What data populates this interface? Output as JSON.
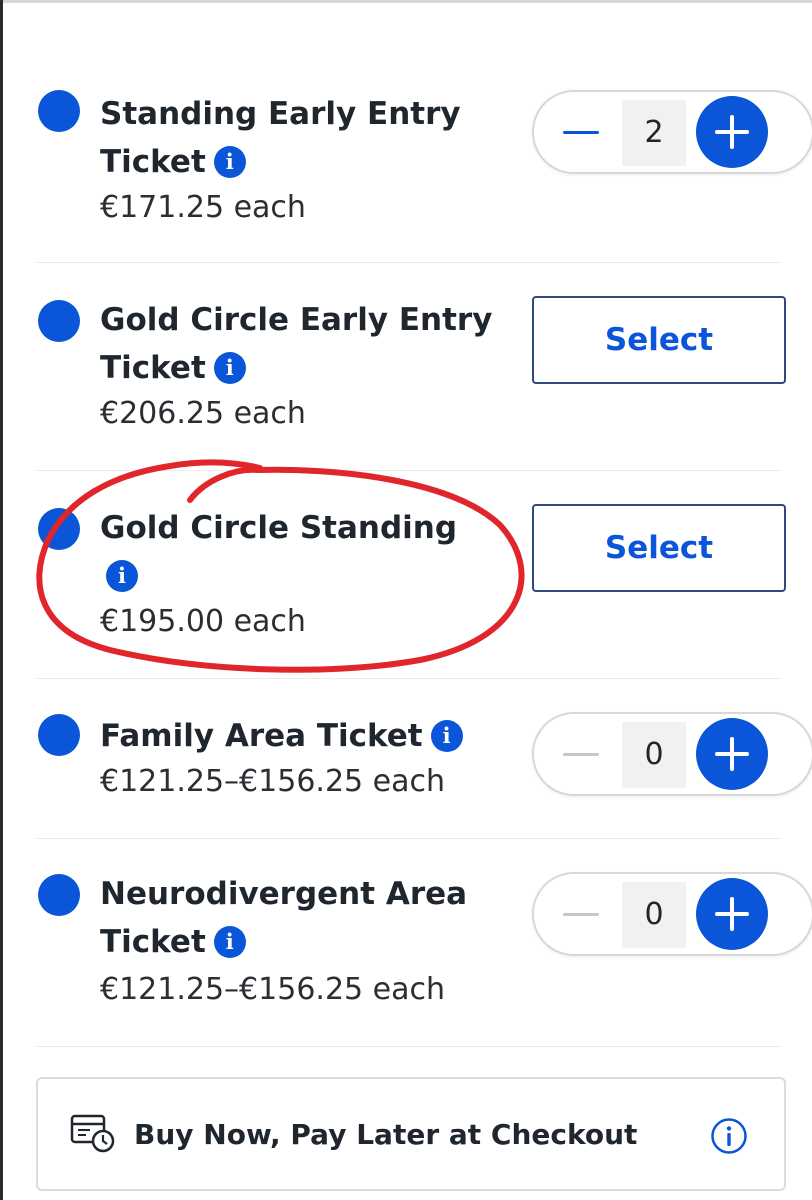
{
  "tickets": [
    {
      "name": "Standing Early Entry Ticket",
      "price": "€171.25 each",
      "control": "stepper",
      "quantity": "2",
      "minus_enabled": true
    },
    {
      "name": "Gold Circle Early Entry Ticket",
      "price": "€206.25 each",
      "control": "select",
      "select_label": "Select"
    },
    {
      "name": "Gold Circle Standing",
      "price": "€195.00 each",
      "control": "select",
      "select_label": "Select",
      "annotated": true
    },
    {
      "name": "Family Area Ticket",
      "price": "€121.25–€156.25 each",
      "control": "stepper",
      "quantity": "0",
      "minus_enabled": false
    },
    {
      "name": "Neurodivergent Area Ticket",
      "price": "€121.25–€156.25 each",
      "control": "stepper",
      "quantity": "0",
      "minus_enabled": false
    }
  ],
  "banner": {
    "text": "Buy Now, Pay Later at Checkout",
    "icon": "calendar-card-icon",
    "info_icon": "info-circle-icon"
  },
  "icons": {
    "bullet": "blue-dot-icon",
    "info": "info-icon",
    "minus": "minus-icon",
    "plus": "plus-icon"
  },
  "colors": {
    "accent": "#0a55d8",
    "annotation": "#e0262b",
    "text": "#1f262d"
  }
}
